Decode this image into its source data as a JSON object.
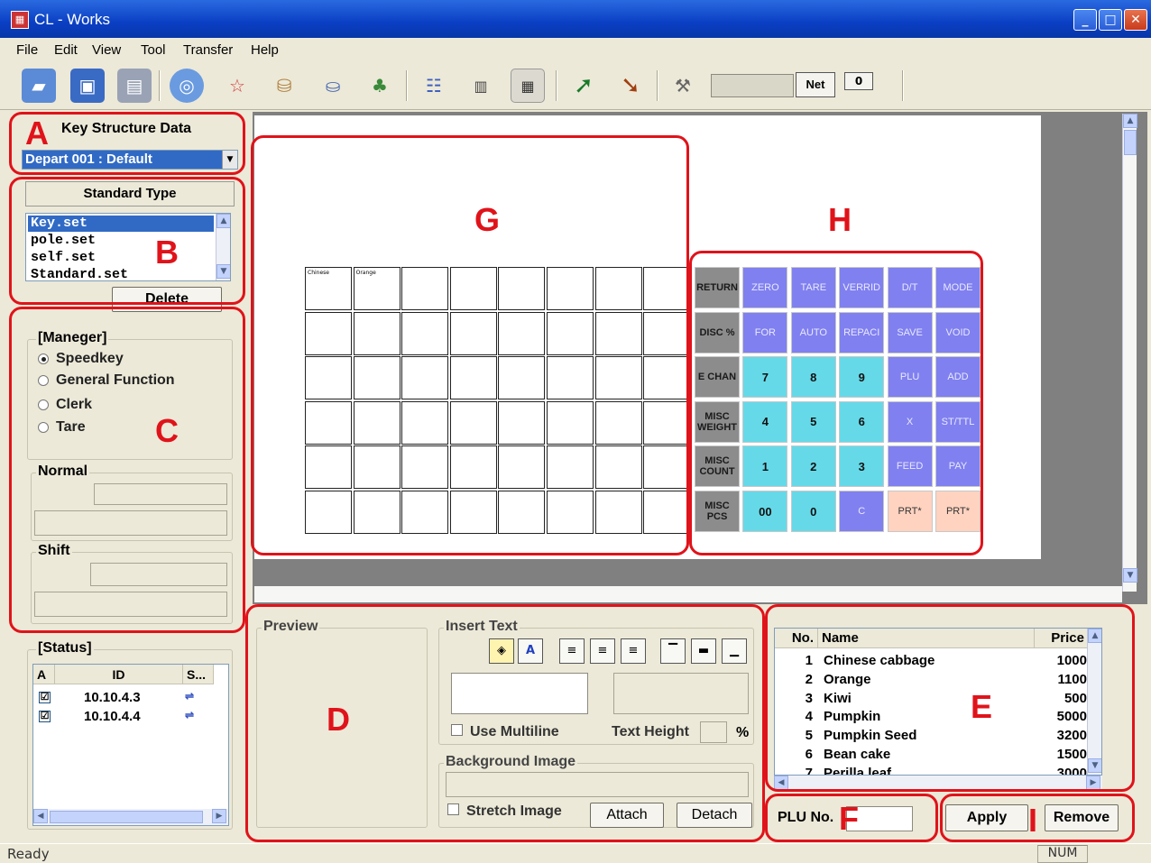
{
  "window": {
    "title": "CL - Works"
  },
  "menu": [
    "File",
    "Edit",
    "View",
    "Tool",
    "Transfer",
    "Help"
  ],
  "toolbar": {
    "net_label": "Net",
    "zero_label": "0"
  },
  "markers": {
    "a": "A",
    "b": "B",
    "c": "C",
    "d": "D",
    "e": "E",
    "f": "F",
    "g": "G",
    "h": "H",
    "i": "I"
  },
  "panel_a": {
    "title": "Key Structure Data",
    "selected": "Depart 001 : Default"
  },
  "panel_b": {
    "header": "Standard Type",
    "items": [
      "Key.set",
      "pole.set",
      "self.set",
      "Standard.set"
    ],
    "delete_label": "Delete"
  },
  "panel_c": {
    "group_title": "[Maneger]",
    "options": [
      "Speedkey",
      "General Function",
      "Clerk",
      "Tare"
    ],
    "normal_label": "Normal",
    "shift_label": "Shift"
  },
  "status": {
    "title": "[Status]",
    "headers": [
      "A",
      "ID",
      "S..."
    ],
    "rows": [
      {
        "checked": "☑",
        "id": "10.10.4.3"
      },
      {
        "checked": "☑",
        "id": "10.10.4.4"
      }
    ]
  },
  "grid_g": {
    "cell_labels": [
      "Chinese",
      "Orange"
    ]
  },
  "keys_h": {
    "rows": [
      [
        {
          "t": "RETURN",
          "c": "gray"
        },
        {
          "t": "ZERO",
          "c": "purple"
        },
        {
          "t": "TARE",
          "c": "purple"
        },
        {
          "t": "VERRID",
          "c": "purple"
        },
        {
          "t": "D/T",
          "c": "purple"
        },
        {
          "t": "MODE",
          "c": "purple"
        }
      ],
      [
        {
          "t": "DISC %",
          "c": "gray"
        },
        {
          "t": "FOR",
          "c": "purple"
        },
        {
          "t": "AUTO",
          "c": "purple"
        },
        {
          "t": "REPACI",
          "c": "purple"
        },
        {
          "t": "SAVE",
          "c": "purple"
        },
        {
          "t": "VOID",
          "c": "purple"
        }
      ],
      [
        {
          "t": "E CHAN",
          "c": "gray"
        },
        {
          "t": "7",
          "c": "cyan"
        },
        {
          "t": "8",
          "c": "cyan"
        },
        {
          "t": "9",
          "c": "cyan"
        },
        {
          "t": "PLU",
          "c": "purple"
        },
        {
          "t": "ADD",
          "c": "purple"
        }
      ],
      [
        {
          "t": "MISC WEIGHT",
          "c": "gray"
        },
        {
          "t": "4",
          "c": "cyan"
        },
        {
          "t": "5",
          "c": "cyan"
        },
        {
          "t": "6",
          "c": "cyan"
        },
        {
          "t": "X",
          "c": "purple"
        },
        {
          "t": "ST/TTL",
          "c": "purple"
        }
      ],
      [
        {
          "t": "MISC COUNT",
          "c": "gray"
        },
        {
          "t": "1",
          "c": "cyan"
        },
        {
          "t": "2",
          "c": "cyan"
        },
        {
          "t": "3",
          "c": "cyan"
        },
        {
          "t": "FEED",
          "c": "purple"
        },
        {
          "t": "PAY",
          "c": "purple"
        }
      ],
      [
        {
          "t": "MISC PCS",
          "c": "gray"
        },
        {
          "t": "00",
          "c": "cyan"
        },
        {
          "t": "0",
          "c": "cyan"
        },
        {
          "t": "C",
          "c": "purple"
        },
        {
          "t": "PRT*",
          "c": "peach"
        },
        {
          "t": "PRT*",
          "c": "peach"
        }
      ]
    ]
  },
  "panel_d": {
    "preview_label": "Preview",
    "insert_text_label": "Insert Text",
    "use_multiline_label": "Use Multiline",
    "text_height_label": "Text Height",
    "percent": "%",
    "bg_image_label": "Background Image",
    "stretch_label": "Stretch Image",
    "attach_label": "Attach",
    "detach_label": "Detach"
  },
  "panel_e": {
    "headers": {
      "no": "No.",
      "name": "Name",
      "price": "Price"
    },
    "rows": [
      {
        "no": "1",
        "name": "Chinese cabbage",
        "price": "1000"
      },
      {
        "no": "2",
        "name": "Orange",
        "price": "1100"
      },
      {
        "no": "3",
        "name": "Kiwi",
        "price": "500"
      },
      {
        "no": "4",
        "name": "Pumpkin",
        "price": "5000"
      },
      {
        "no": "5",
        "name": "Pumpkin Seed",
        "price": "3200"
      },
      {
        "no": "6",
        "name": "Bean cake",
        "price": "1500"
      },
      {
        "no": "7",
        "name": "Perilla leaf",
        "price": "3000"
      }
    ]
  },
  "panel_f": {
    "plu_label": "PLU No."
  },
  "panel_i": {
    "apply_label": "Apply",
    "remove_label": "Remove"
  },
  "statusbar": {
    "left": "Ready",
    "num": "NUM"
  }
}
